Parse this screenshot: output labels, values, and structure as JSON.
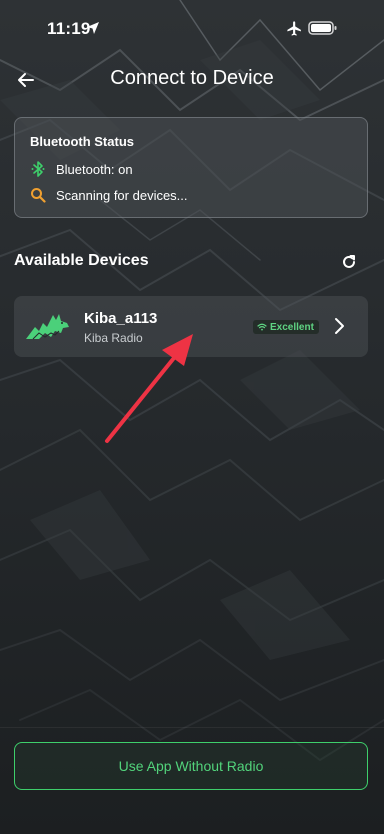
{
  "status_bar": {
    "time": "11:19",
    "icons": [
      "location-arrow-icon",
      "airplane-icon",
      "battery-icon"
    ]
  },
  "nav": {
    "title": "Connect to Device",
    "back_icon": "arrow-left-icon"
  },
  "bluetooth_card": {
    "title": "Bluetooth Status",
    "items": [
      {
        "icon": "bluetooth-icon",
        "text": "Bluetooth: on",
        "color": "#3ecf6b"
      },
      {
        "icon": "search-icon",
        "text": "Scanning for devices...",
        "color": "#f0a030"
      }
    ]
  },
  "available_devices": {
    "title": "Available Devices",
    "refresh_icon": "refresh-icon",
    "devices": [
      {
        "name": "Kiba_a113",
        "type": "Kiba Radio",
        "signal": "Excellent",
        "logo_icon": "wolf-logo-icon",
        "chevron_icon": "chevron-right-icon"
      }
    ]
  },
  "footer": {
    "use_app_label": "Use App Without Radio"
  },
  "colors": {
    "accent_green": "#3ecf6b",
    "scanning_orange": "#f0a030",
    "annotation_red": "#ee3344"
  }
}
